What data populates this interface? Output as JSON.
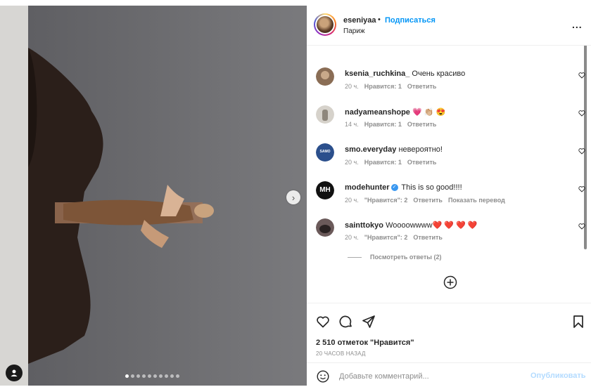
{
  "post": {
    "author": {
      "username": "eseniyaa",
      "separator": "•",
      "follow_label": "Подписаться",
      "location": "Париж",
      "more_label": "..."
    },
    "carousel": {
      "slide_count": 10,
      "active_slide": 1,
      "next_icon": "chevron-right-icon"
    },
    "comments": [
      {
        "username": "ksenia_ruchkina_",
        "text": "Очень красиво",
        "time": "20 ч.",
        "likes": "Нравится: 1",
        "reply": "Ответить",
        "avatar_color": "#8a6d55"
      },
      {
        "username": "nadyameanshope",
        "text": "💗 👏🏼 😍",
        "time": "14 ч.",
        "likes": "Нравится: 1",
        "reply": "Ответить",
        "avatar_color": "#b8b2a8"
      },
      {
        "username": "smo.everyday",
        "text": "невероятно!",
        "time": "20 ч.",
        "likes": "Нравится: 1",
        "reply": "Ответить",
        "avatar_color": "#2b4f8c",
        "avatar_text": "SAMO"
      },
      {
        "username": "modehunter",
        "verified": true,
        "text": "This is so good!!!!",
        "time": "20 ч.",
        "likes": "\"Нравится\": 2",
        "reply": "Ответить",
        "translate": "Показать перевод",
        "avatar_color": "#111111",
        "avatar_text": "MH"
      },
      {
        "username": "sainttokyo",
        "text": "Woooowwww❤️ ❤️ ❤️ ❤️",
        "time": "20 ч.",
        "likes": "\"Нравится\": 2",
        "reply": "Ответить",
        "avatar_color": "#6b5a5a"
      }
    ],
    "view_replies": "Посмотреть ответы (2)",
    "likes_count": "2 510 отметок \"Нравится\"",
    "posted_time": "20 ЧАСОВ НАЗАД",
    "comment_input": {
      "placeholder": "Добавьте комментарий...",
      "submit_label": "Опубликовать"
    },
    "colors": {
      "accent": "#0095f6",
      "text": "#262626",
      "muted": "#8e8e8e"
    }
  }
}
